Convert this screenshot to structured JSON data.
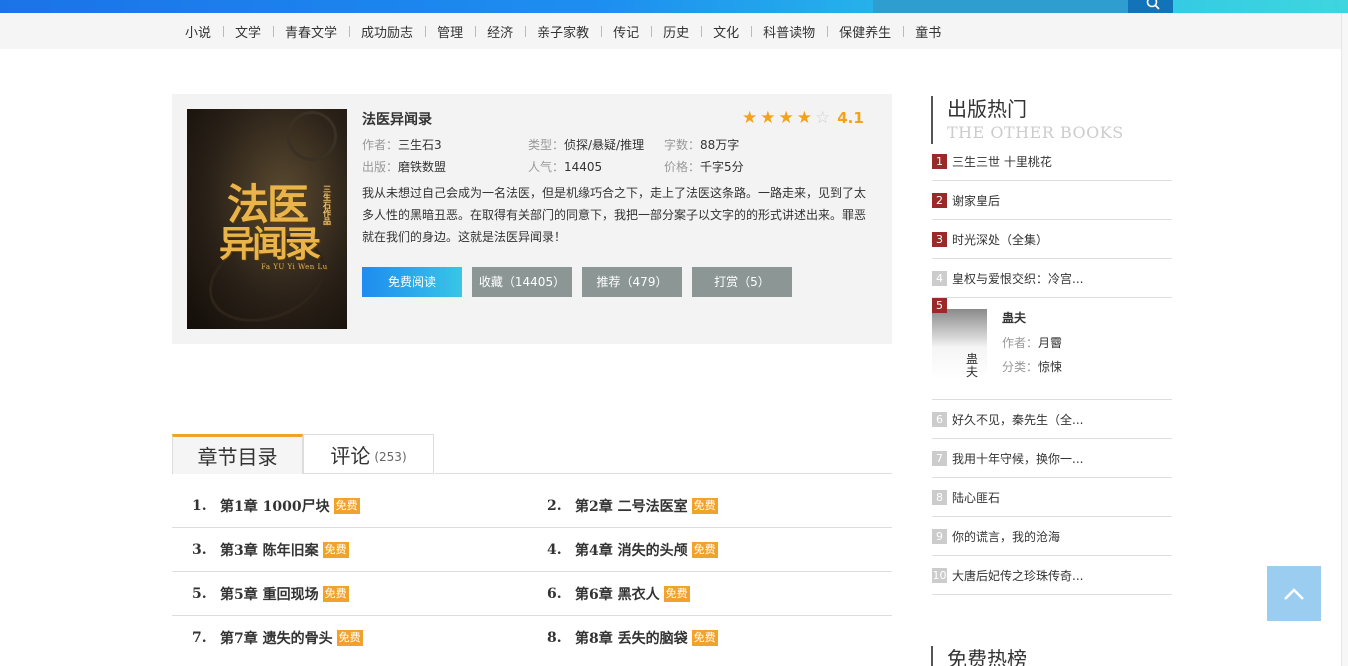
{
  "nav": {
    "categories": [
      "小说",
      "文学",
      "青春文学",
      "成功励志",
      "管理",
      "经济",
      "亲子家教",
      "传记",
      "历史",
      "文化",
      "科普读物",
      "保健养生",
      "童书"
    ]
  },
  "book": {
    "title": "法医异闻录",
    "cover_text": {
      "line1": "法医",
      "line2": "异闻录",
      "side": "三生石作品",
      "pinyin": "Fa YU Yi Wen Lu"
    },
    "rating": 4.1,
    "rating_text": "4.1",
    "stars": [
      true,
      true,
      true,
      true,
      false
    ],
    "author_label": "作者：",
    "author": "三生石3",
    "type_label": "类型：",
    "type": "侦探/悬疑/推理",
    "words_label": "字数：",
    "words": "88万字",
    "publisher_label": "出版：",
    "publisher": "磨铁数盟",
    "popularity_label": "人气：",
    "popularity": "14405",
    "price_label": "价格：",
    "price": "千字5分",
    "intro": "我从未想过自己会成为一名法医，但是机缘巧合之下，走上了法医这条路。一路走来，见到了太多人性的黑暗丑恶。在取得有关部门的同意下，我把一部分案子以文字的的形式讲述出来。罪恶就在我们的身边。这就是法医异闻录！",
    "actions": {
      "read": "免费阅读",
      "collect": "收藏（14405）",
      "recommend": "推荐（479）",
      "tip": "打赏（5）"
    }
  },
  "tabs": {
    "catalog": "章节目录",
    "comments": "评论",
    "comments_count": "(253)"
  },
  "chapters": [
    {
      "num": "1.",
      "title": "第1章  1000尸块",
      "tag": "免费"
    },
    {
      "num": "2.",
      "title": "第2章  二号法医室",
      "tag": "免费"
    },
    {
      "num": "3.",
      "title": "第3章  陈年旧案",
      "tag": "免费"
    },
    {
      "num": "4.",
      "title": "第4章  消失的头颅",
      "tag": "免费"
    },
    {
      "num": "5.",
      "title": "第5章  重回现场",
      "tag": "免费"
    },
    {
      "num": "6.",
      "title": "第6章  黑衣人",
      "tag": "免费"
    },
    {
      "num": "7.",
      "title": "第7章  遗失的骨头",
      "tag": "免费"
    },
    {
      "num": "8.",
      "title": "第8章  丢失的脑袋",
      "tag": "免费"
    }
  ],
  "sidebar": {
    "title_cn": "出版热门",
    "title_en": "THE OTHER BOOKS",
    "rank": [
      {
        "n": "1",
        "title": "三生三世 十里桃花"
      },
      {
        "n": "2",
        "title": "谢家皇后"
      },
      {
        "n": "3",
        "title": "时光深处（全集）"
      },
      {
        "n": "4",
        "title": "皇权与爱恨交织：冷宫..."
      },
      {
        "n": "5",
        "title": "蛊夫",
        "author_label": "作者：",
        "author": "月霫",
        "category_label": "分类：",
        "category": "惊悚",
        "thumb_text": "蛊夫"
      },
      {
        "n": "6",
        "title": "好久不见，秦先生（全..."
      },
      {
        "n": "7",
        "title": "我用十年守候，换你一..."
      },
      {
        "n": "8",
        "title": "陆心匪石"
      },
      {
        "n": "9",
        "title": "你的谎言，我的沧海"
      },
      {
        "n": "10",
        "title": "大唐后妃传之珍珠传奇..."
      }
    ],
    "title2_cn": "免费热榜"
  },
  "colors": {
    "accent": "#f1a22a",
    "brand_blue": "#1e8cf0",
    "hot_rank": "#9a2a2a"
  }
}
